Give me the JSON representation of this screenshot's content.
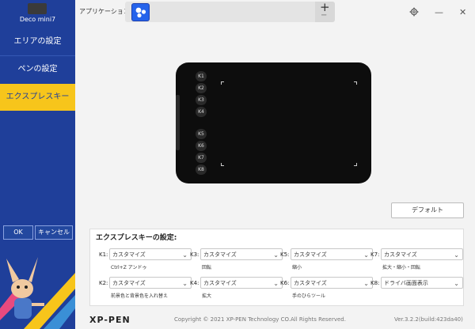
{
  "sidebar": {
    "device_name": "Deco mini7",
    "items": [
      {
        "label": "エリアの設定"
      },
      {
        "label": "ペンの設定"
      },
      {
        "label": "エクスプレスキー"
      }
    ],
    "ok_label": "OK",
    "cancel_label": "キャンセル"
  },
  "topbar": {
    "app_label": "アプリケーション:",
    "add_glyph": "+",
    "remove_glyph": "−",
    "settings_icon": "gear-icon",
    "minimize_glyph": "—",
    "close_glyph": "✕"
  },
  "tablet": {
    "keys": [
      "K1",
      "K2",
      "K3",
      "K4",
      "K5",
      "K6",
      "K7",
      "K8"
    ]
  },
  "default_button": "デフォルト",
  "express_panel": {
    "title": "エクスプレスキーの設定:",
    "keys": [
      {
        "label": "K1:",
        "value": "カスタマイズ",
        "sub": "Ctrl+Z アンドゥ"
      },
      {
        "label": "K3:",
        "value": "カスタマイズ",
        "sub": "回転"
      },
      {
        "label": "K5:",
        "value": "カスタマイズ",
        "sub": "縮小"
      },
      {
        "label": "K7:",
        "value": "カスタマイズ",
        "sub": "拡大・縮小・回転"
      },
      {
        "label": "K2:",
        "value": "カスタマイズ",
        "sub": "前景色と背景色を入れ替え"
      },
      {
        "label": "K4:",
        "value": "カスタマイズ",
        "sub": "拡大"
      },
      {
        "label": "K6:",
        "value": "カスタマイズ",
        "sub": "手のひらツール"
      },
      {
        "label": "K8:",
        "value": "ドライバ画面表示",
        "sub": ""
      }
    ]
  },
  "footer": {
    "logo": "XP-PEN",
    "copyright": "Copyright © 2021 XP-PEN Technology CO.All Rights Reserved.",
    "version": "Ver.3.2.2(build:423da40)"
  },
  "colors": {
    "sidebar": "#1f3f9a",
    "active": "#f7c51b",
    "accent": "#2563eb"
  }
}
